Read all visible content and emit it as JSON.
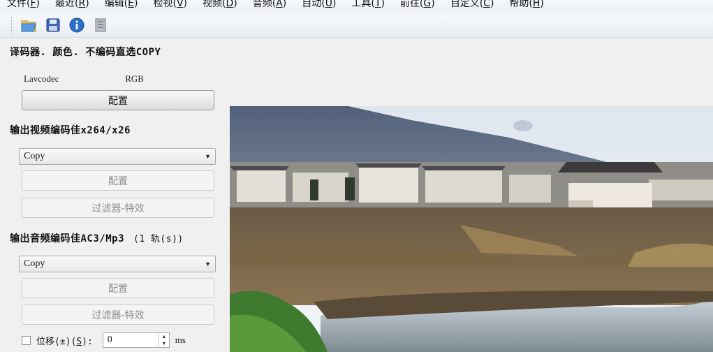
{
  "menu": [
    {
      "label": "文件(",
      "key": "F",
      "suffix": ")"
    },
    {
      "label": "最近(",
      "key": "R",
      "suffix": ")"
    },
    {
      "label": "编辑(",
      "key": "E",
      "suffix": ")"
    },
    {
      "label": "检视(",
      "key": "V",
      "suffix": ")"
    },
    {
      "label": "视频(",
      "key": "D",
      "suffix": ")"
    },
    {
      "label": "音频(",
      "key": "A",
      "suffix": ")"
    },
    {
      "label": "自动(",
      "key": "U",
      "suffix": ")"
    },
    {
      "label": "工具(",
      "key": "T",
      "suffix": ")"
    },
    {
      "label": "前往(",
      "key": "G",
      "suffix": ")"
    },
    {
      "label": "自定义(",
      "key": "C",
      "suffix": ")"
    },
    {
      "label": "帮助(",
      "key": "H",
      "suffix": ")"
    }
  ],
  "toolbar": {
    "icons": [
      "open-folder-icon",
      "save-disk-icon",
      "info-icon",
      "properties-icon"
    ]
  },
  "decoder": {
    "title": "译码器. 颜色. 不编码直选COPY",
    "codec": "Lavcodec",
    "color": "RGB",
    "config_label": "配置"
  },
  "video": {
    "title": "输出视频编码佳x264/x26",
    "selected": "Copy",
    "config_label": "配置",
    "filter_label": "过滤器-特效"
  },
  "audio": {
    "title": "输出音频编码佳AC3/Mp3",
    "tracks": "(1 轨(s))",
    "selected": "Copy",
    "config_label": "配置",
    "filter_label": "过滤器-特效"
  },
  "offset": {
    "label_prefix": "位移(±)(",
    "label_key": "S",
    "label_suffix": "):",
    "value": "0",
    "unit": "ms",
    "checked": false
  },
  "colors": {
    "sky_top": "#5d6a82",
    "sky_light": "#e9eef3",
    "accent_blue": "#2a6fc9"
  }
}
